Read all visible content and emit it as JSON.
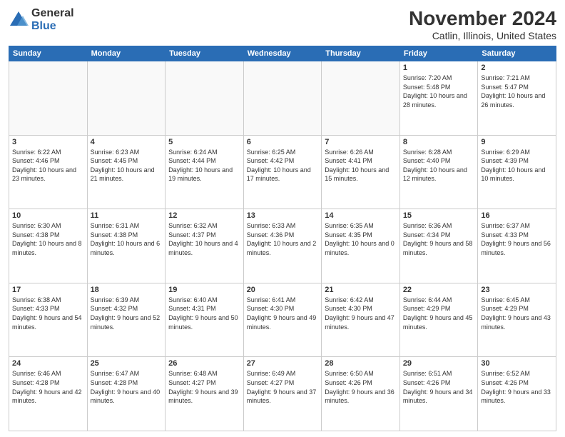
{
  "logo": {
    "general": "General",
    "blue": "Blue"
  },
  "header": {
    "title": "November 2024",
    "subtitle": "Catlin, Illinois, United States"
  },
  "days_of_week": [
    "Sunday",
    "Monday",
    "Tuesday",
    "Wednesday",
    "Thursday",
    "Friday",
    "Saturday"
  ],
  "weeks": [
    [
      {
        "day": "",
        "sunrise": "",
        "sunset": "",
        "daylight": ""
      },
      {
        "day": "",
        "sunrise": "",
        "sunset": "",
        "daylight": ""
      },
      {
        "day": "",
        "sunrise": "",
        "sunset": "",
        "daylight": ""
      },
      {
        "day": "",
        "sunrise": "",
        "sunset": "",
        "daylight": ""
      },
      {
        "day": "",
        "sunrise": "",
        "sunset": "",
        "daylight": ""
      },
      {
        "day": "1",
        "sunrise": "Sunrise: 7:20 AM",
        "sunset": "Sunset: 5:48 PM",
        "daylight": "Daylight: 10 hours and 28 minutes."
      },
      {
        "day": "2",
        "sunrise": "Sunrise: 7:21 AM",
        "sunset": "Sunset: 5:47 PM",
        "daylight": "Daylight: 10 hours and 26 minutes."
      }
    ],
    [
      {
        "day": "3",
        "sunrise": "Sunrise: 6:22 AM",
        "sunset": "Sunset: 4:46 PM",
        "daylight": "Daylight: 10 hours and 23 minutes."
      },
      {
        "day": "4",
        "sunrise": "Sunrise: 6:23 AM",
        "sunset": "Sunset: 4:45 PM",
        "daylight": "Daylight: 10 hours and 21 minutes."
      },
      {
        "day": "5",
        "sunrise": "Sunrise: 6:24 AM",
        "sunset": "Sunset: 4:44 PM",
        "daylight": "Daylight: 10 hours and 19 minutes."
      },
      {
        "day": "6",
        "sunrise": "Sunrise: 6:25 AM",
        "sunset": "Sunset: 4:42 PM",
        "daylight": "Daylight: 10 hours and 17 minutes."
      },
      {
        "day": "7",
        "sunrise": "Sunrise: 6:26 AM",
        "sunset": "Sunset: 4:41 PM",
        "daylight": "Daylight: 10 hours and 15 minutes."
      },
      {
        "day": "8",
        "sunrise": "Sunrise: 6:28 AM",
        "sunset": "Sunset: 4:40 PM",
        "daylight": "Daylight: 10 hours and 12 minutes."
      },
      {
        "day": "9",
        "sunrise": "Sunrise: 6:29 AM",
        "sunset": "Sunset: 4:39 PM",
        "daylight": "Daylight: 10 hours and 10 minutes."
      }
    ],
    [
      {
        "day": "10",
        "sunrise": "Sunrise: 6:30 AM",
        "sunset": "Sunset: 4:38 PM",
        "daylight": "Daylight: 10 hours and 8 minutes."
      },
      {
        "day": "11",
        "sunrise": "Sunrise: 6:31 AM",
        "sunset": "Sunset: 4:38 PM",
        "daylight": "Daylight: 10 hours and 6 minutes."
      },
      {
        "day": "12",
        "sunrise": "Sunrise: 6:32 AM",
        "sunset": "Sunset: 4:37 PM",
        "daylight": "Daylight: 10 hours and 4 minutes."
      },
      {
        "day": "13",
        "sunrise": "Sunrise: 6:33 AM",
        "sunset": "Sunset: 4:36 PM",
        "daylight": "Daylight: 10 hours and 2 minutes."
      },
      {
        "day": "14",
        "sunrise": "Sunrise: 6:35 AM",
        "sunset": "Sunset: 4:35 PM",
        "daylight": "Daylight: 10 hours and 0 minutes."
      },
      {
        "day": "15",
        "sunrise": "Sunrise: 6:36 AM",
        "sunset": "Sunset: 4:34 PM",
        "daylight": "Daylight: 9 hours and 58 minutes."
      },
      {
        "day": "16",
        "sunrise": "Sunrise: 6:37 AM",
        "sunset": "Sunset: 4:33 PM",
        "daylight": "Daylight: 9 hours and 56 minutes."
      }
    ],
    [
      {
        "day": "17",
        "sunrise": "Sunrise: 6:38 AM",
        "sunset": "Sunset: 4:33 PM",
        "daylight": "Daylight: 9 hours and 54 minutes."
      },
      {
        "day": "18",
        "sunrise": "Sunrise: 6:39 AM",
        "sunset": "Sunset: 4:32 PM",
        "daylight": "Daylight: 9 hours and 52 minutes."
      },
      {
        "day": "19",
        "sunrise": "Sunrise: 6:40 AM",
        "sunset": "Sunset: 4:31 PM",
        "daylight": "Daylight: 9 hours and 50 minutes."
      },
      {
        "day": "20",
        "sunrise": "Sunrise: 6:41 AM",
        "sunset": "Sunset: 4:30 PM",
        "daylight": "Daylight: 9 hours and 49 minutes."
      },
      {
        "day": "21",
        "sunrise": "Sunrise: 6:42 AM",
        "sunset": "Sunset: 4:30 PM",
        "daylight": "Daylight: 9 hours and 47 minutes."
      },
      {
        "day": "22",
        "sunrise": "Sunrise: 6:44 AM",
        "sunset": "Sunset: 4:29 PM",
        "daylight": "Daylight: 9 hours and 45 minutes."
      },
      {
        "day": "23",
        "sunrise": "Sunrise: 6:45 AM",
        "sunset": "Sunset: 4:29 PM",
        "daylight": "Daylight: 9 hours and 43 minutes."
      }
    ],
    [
      {
        "day": "24",
        "sunrise": "Sunrise: 6:46 AM",
        "sunset": "Sunset: 4:28 PM",
        "daylight": "Daylight: 9 hours and 42 minutes."
      },
      {
        "day": "25",
        "sunrise": "Sunrise: 6:47 AM",
        "sunset": "Sunset: 4:28 PM",
        "daylight": "Daylight: 9 hours and 40 minutes."
      },
      {
        "day": "26",
        "sunrise": "Sunrise: 6:48 AM",
        "sunset": "Sunset: 4:27 PM",
        "daylight": "Daylight: 9 hours and 39 minutes."
      },
      {
        "day": "27",
        "sunrise": "Sunrise: 6:49 AM",
        "sunset": "Sunset: 4:27 PM",
        "daylight": "Daylight: 9 hours and 37 minutes."
      },
      {
        "day": "28",
        "sunrise": "Sunrise: 6:50 AM",
        "sunset": "Sunset: 4:26 PM",
        "daylight": "Daylight: 9 hours and 36 minutes."
      },
      {
        "day": "29",
        "sunrise": "Sunrise: 6:51 AM",
        "sunset": "Sunset: 4:26 PM",
        "daylight": "Daylight: 9 hours and 34 minutes."
      },
      {
        "day": "30",
        "sunrise": "Sunrise: 6:52 AM",
        "sunset": "Sunset: 4:26 PM",
        "daylight": "Daylight: 9 hours and 33 minutes."
      }
    ]
  ]
}
